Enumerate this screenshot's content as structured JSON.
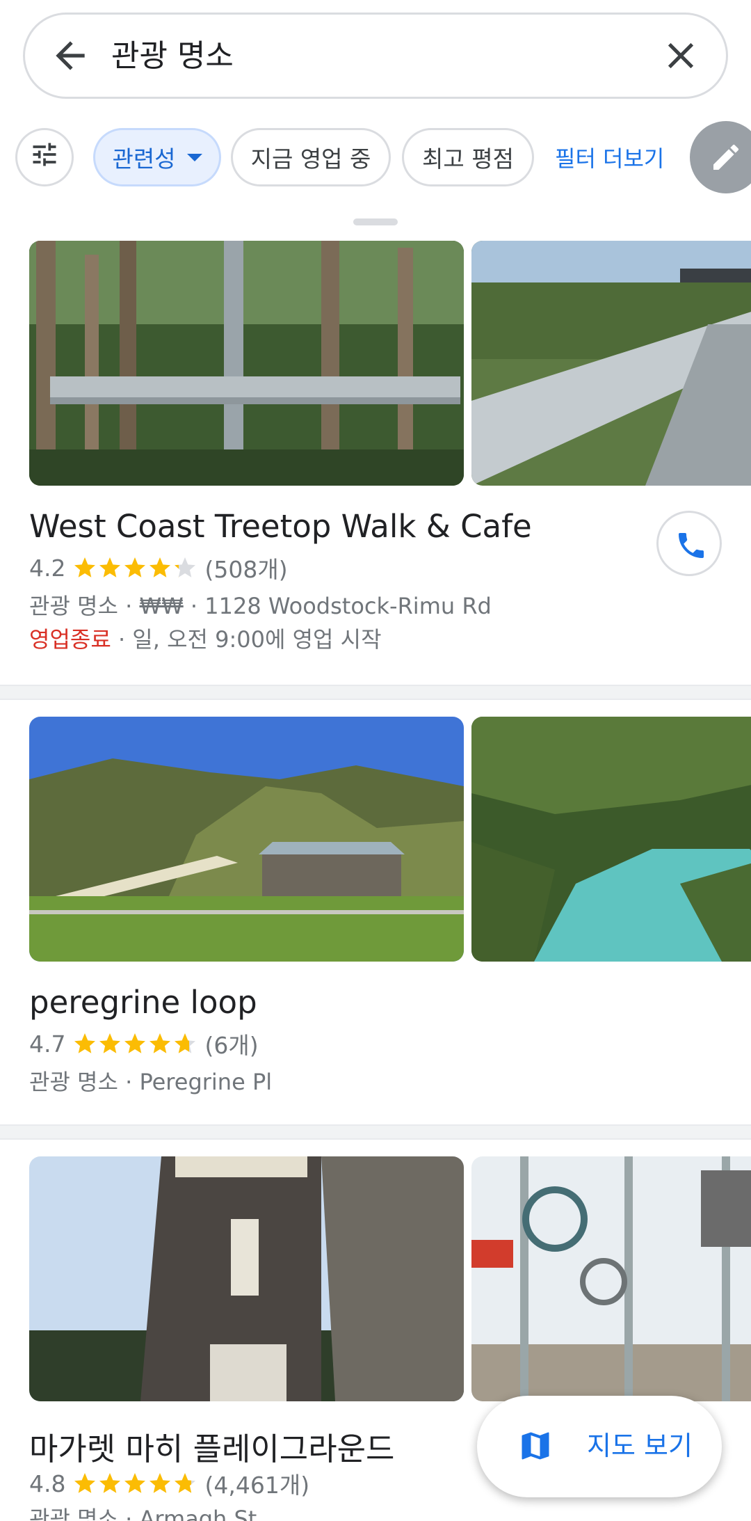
{
  "search": {
    "query": "관광 명소"
  },
  "filters": {
    "relevance": "관련성",
    "open_now": "지금 영업 중",
    "top_rated": "최고 평점",
    "more": "필터 더보기"
  },
  "results": [
    {
      "name": "West Coast Treetop Walk & Cafe",
      "rating": "4.2",
      "rating_value": 4.2,
      "reviews": "(508개)",
      "category": "관광 명소",
      "price": "₩₩",
      "address": "1128 Woodstock-Rimu Rd",
      "status": "영업종료",
      "hours": "일, 오전 9:00에 영업 시작"
    },
    {
      "name": "peregrine loop",
      "rating": "4.7",
      "rating_value": 4.7,
      "reviews": "(6개)",
      "category": "관광 명소",
      "address": "Peregrine Pl"
    },
    {
      "name": "마가렛 마히 플레이그라운드",
      "rating": "4.8",
      "rating_value": 4.8,
      "reviews": "(4,461개)",
      "category": "관광 명소",
      "address": "Armagh St"
    }
  ],
  "map_button": {
    "label": "지도 보기"
  },
  "colors": {
    "accent": "#1a73e8",
    "star": "#fbbc04",
    "closed": "#d93025"
  },
  "icons": [
    "back-arrow-icon",
    "close-icon",
    "tune-icon",
    "caret-down-icon",
    "edit-icon",
    "phone-icon",
    "star-icon",
    "map-icon"
  ]
}
